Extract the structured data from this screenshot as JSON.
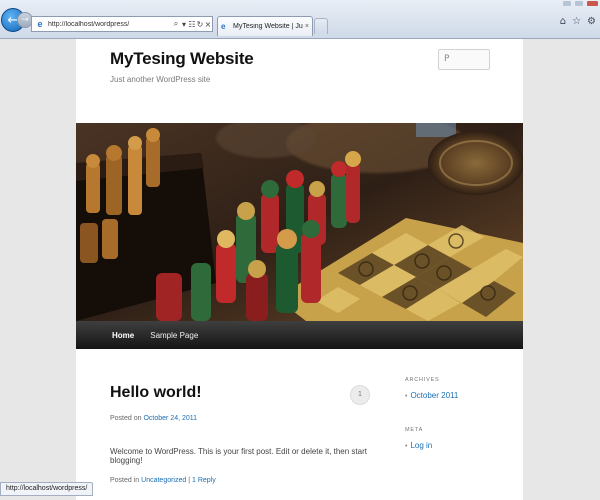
{
  "browser": {
    "address_url": "http://localhost/wordpress/",
    "tab_title": "MyTesing Website | Just an...",
    "status_text": "http://localhost/wordpress/"
  },
  "site": {
    "title": "MyTesing Website",
    "description": "Just another WordPress site",
    "search_placeholder": "P"
  },
  "nav": {
    "items": [
      "Home",
      "Sample Page"
    ]
  },
  "post": {
    "title": "Hello world!",
    "comment_count": "1",
    "posted_on_label": "Posted on",
    "date": "October 24, 2011",
    "body": "Welcome to WordPress. This is your first post. Edit or delete it, then start blogging!",
    "posted_in_label": "Posted in",
    "category": "Uncategorized",
    "separator": "|",
    "reply_link": "1 Reply"
  },
  "sidebar": {
    "archives_title": "ARCHIVES",
    "archives_items": [
      "October 2011"
    ],
    "meta_title": "META",
    "meta_items": [
      "Log in"
    ]
  },
  "colors": {
    "link": "#1b6fb3",
    "nav_background": "#222222"
  }
}
